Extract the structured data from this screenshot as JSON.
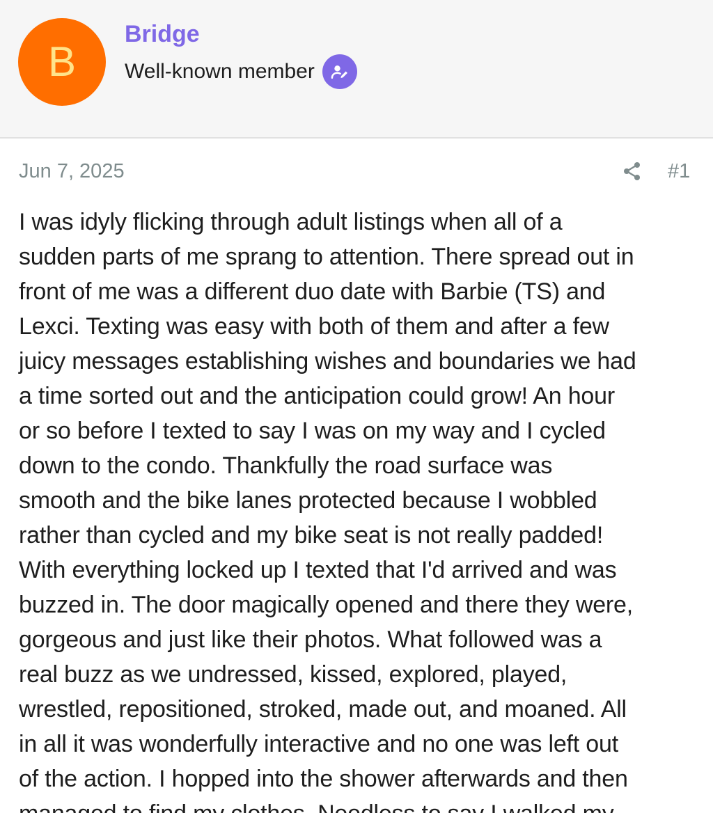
{
  "user": {
    "avatar_letter": "B",
    "name": "Bridge",
    "title": "Well-known member",
    "badge_icon": "verified-edit-icon"
  },
  "post": {
    "date": "Jun 7, 2025",
    "number": "#1",
    "share_icon": "share-icon",
    "body_lines": [
      "I was idyly flicking through adult listings when all of a",
      "sudden parts of me sprang to attention. There spread out in",
      "front of me was a different duo date with Barbie (TS) and",
      "Lexci. Texting was easy with both of them and after a few",
      "juicy messages establishing wishes and boundaries we had",
      "a time sorted out and the anticipation could grow! An hour",
      "or so before I texted to say I was on my way and I cycled",
      "down to the condo. Thankfully the road surface was",
      "smooth and the bike lanes protected because I wobbled",
      "rather than cycled and my bike seat is not really padded!",
      "With everything locked up I texted that I'd arrived and was",
      "buzzed in. The door magically opened and there they were,",
      "gorgeous and just like their photos. What followed was a",
      "real buzz as we undressed, kissed, explored, played,",
      "wrestled, repositioned, stroked, made out, and moaned. All",
      "in all it was wonderfully interactive and no one was left out",
      "of the action. I hopped into the shower afterwards and then",
      "managed to find my clothes. Needless to say I walked my"
    ]
  },
  "colors": {
    "accent": "#7f68e6",
    "avatar_bg": "#ff6e00",
    "avatar_letter": "#ffe38a",
    "muted": "#7f8c8d",
    "text": "#1e1e1e",
    "header_bg": "#f6f6f6"
  }
}
